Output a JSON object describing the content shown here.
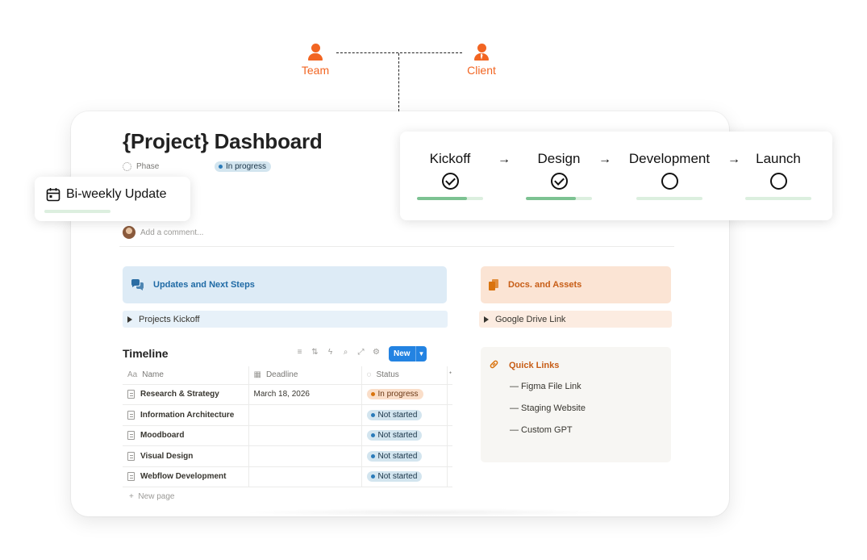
{
  "org": {
    "team_label": "Team",
    "client_label": "Client"
  },
  "page": {
    "title": "{Project} Dashboard",
    "phase_label": "Phase",
    "phase_value": "In progress",
    "comment_placeholder": "Add a comment..."
  },
  "biweekly": {
    "label": "Bi-weekly Update",
    "icon": "calendar-icon"
  },
  "phases": [
    {
      "name": "Kickoff",
      "state": "done",
      "progress": 0.75
    },
    {
      "name": "Design",
      "state": "done",
      "progress": 0.75
    },
    {
      "name": "Development",
      "state": "pending",
      "progress": 0
    },
    {
      "name": "Launch",
      "state": "pending",
      "progress": 0
    }
  ],
  "arrow_glyph": "→",
  "updates": {
    "title": "Updates and Next Steps",
    "toggle": "Projects Kickoff",
    "icon": "chat-bubbles-icon"
  },
  "docs": {
    "title": "Docs. and Assets",
    "toggle": "Google Drive Link",
    "icon": "documents-icon"
  },
  "timeline": {
    "title": "Timeline",
    "new_label": "New",
    "columns": {
      "name": "Name",
      "deadline": "Deadline",
      "status": "Status"
    },
    "rows": [
      {
        "name": "Research & Strategy",
        "deadline": "March 18, 2026",
        "status": "In progress"
      },
      {
        "name": "Information Architecture",
        "deadline": "",
        "status": "Not started"
      },
      {
        "name": "Moodboard",
        "deadline": "",
        "status": "Not started"
      },
      {
        "name": "Visual Design",
        "deadline": "",
        "status": "Not started"
      },
      {
        "name": "Webflow Development",
        "deadline": "",
        "status": "Not started"
      }
    ],
    "new_page": "New page"
  },
  "quick_links": {
    "title": "Quick Links",
    "icon": "link-icon",
    "items": [
      "— Figma File Link",
      "— Staging Website",
      "— Custom GPT"
    ]
  },
  "colors": {
    "accent_orange": "#f26522",
    "blue_callout": "#ddebf6",
    "peach_callout": "#fbe4d4",
    "progress_green": "#7cc292",
    "button_blue": "#2383e2"
  }
}
